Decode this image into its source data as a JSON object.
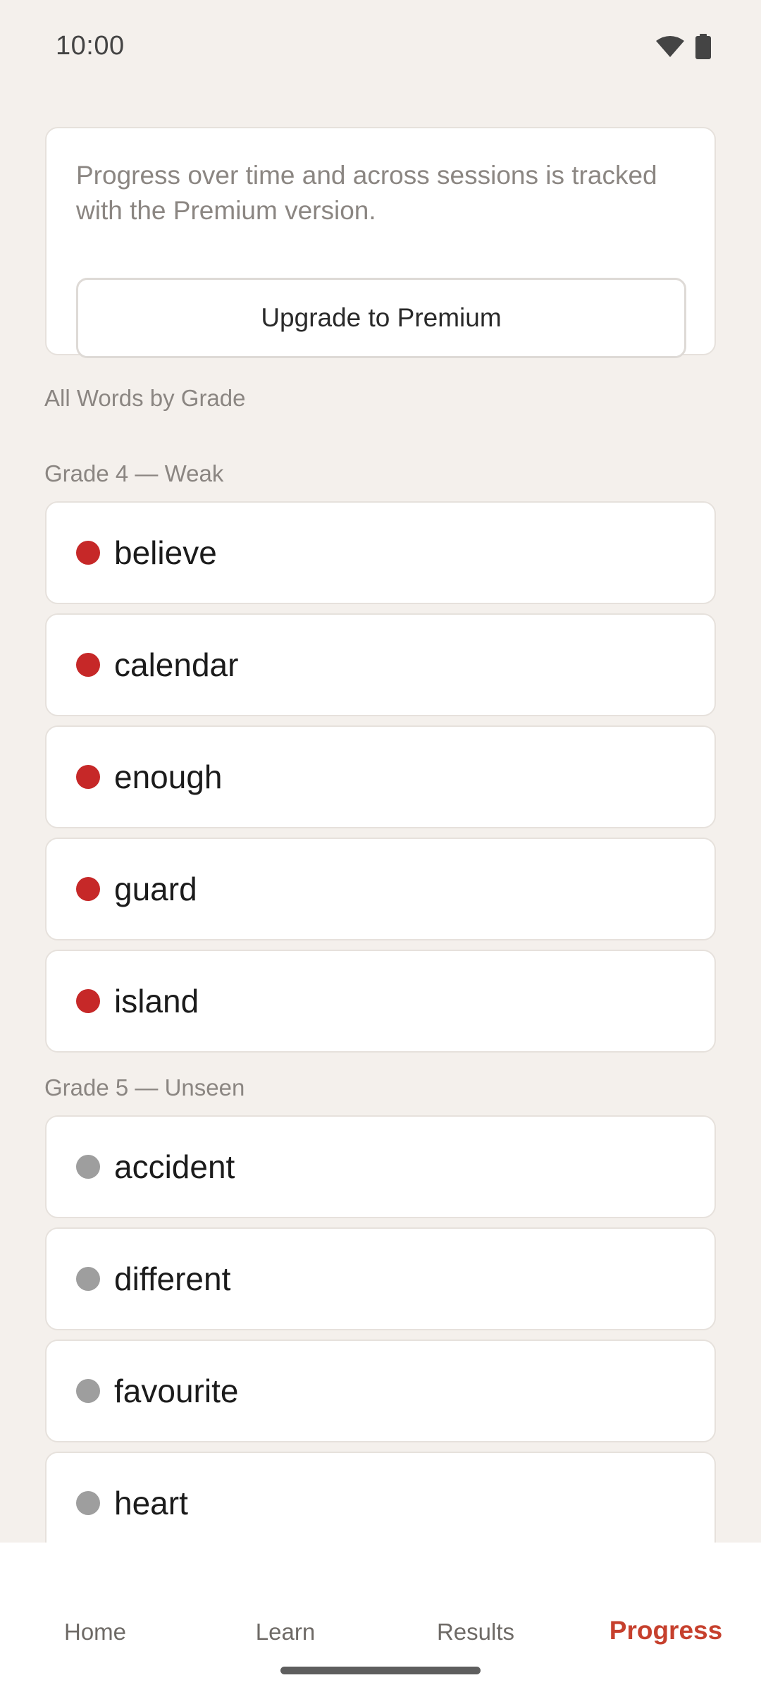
{
  "status_bar": {
    "time": "10:00"
  },
  "premium": {
    "message": "Progress over time and across sessions is tracked with the Premium version.",
    "button_label": "Upgrade to Premium"
  },
  "section_title": "All Words by Grade",
  "groups": [
    {
      "title": "Grade 4 — Weak",
      "status_color": "#c62828",
      "words": [
        "believe",
        "calendar",
        "enough",
        "guard",
        "island"
      ]
    },
    {
      "title": "Grade 5 — Unseen",
      "status_color": "#9e9e9e",
      "words": [
        "accident",
        "different",
        "favourite",
        "heart"
      ]
    }
  ],
  "nav": {
    "items": [
      "Home",
      "Learn",
      "Results",
      "Progress"
    ],
    "active": "Progress",
    "active_color": "#c6402d"
  }
}
